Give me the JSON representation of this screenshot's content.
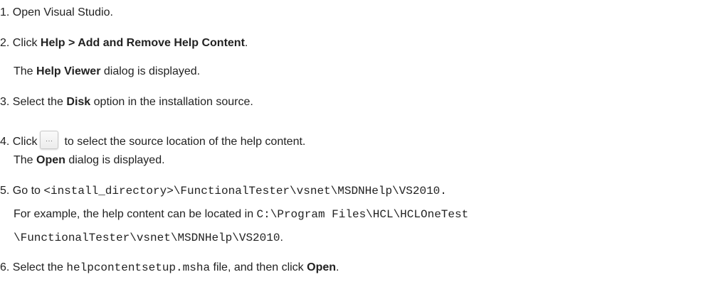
{
  "steps": [
    {
      "num": "1.",
      "text": "Open Visual Studio."
    },
    {
      "num": "2.",
      "pre": "Click ",
      "bold": "Help > Add and Remove Help Content",
      "post": ".",
      "sub_pre": "The ",
      "sub_bold": "Help Viewer",
      "sub_post": " dialog is displayed."
    },
    {
      "num": "3.",
      "pre": "Select the ",
      "bold": "Disk",
      "post": " option in the installation source."
    },
    {
      "num": "4.",
      "pre": "Click",
      "button_icon": "ellipsis-button-icon",
      "button_glyph": "...",
      "post": "to select the source location of the help content.",
      "sub_pre": "The ",
      "sub_bold": "Open",
      "sub_post": " dialog is displayed."
    },
    {
      "num": "5.",
      "pre": "Go to ",
      "code": "<install_directory>\\FunctionalTester\\vsnet\\MSDNHelp\\VS2010.",
      "sub_pre": "For example, the help content can be located in ",
      "sub_code": "C:\\Program Files\\HCL\\HCLOneTest",
      "sub2_code": "\\FunctionalTester\\vsnet\\MSDNHelp\\VS2010",
      "sub2_post": "."
    },
    {
      "num": "6.",
      "pre": "Select the ",
      "code": "helpcontentsetup.msha",
      "mid": " file, and then click ",
      "bold": "Open",
      "post": "."
    }
  ]
}
